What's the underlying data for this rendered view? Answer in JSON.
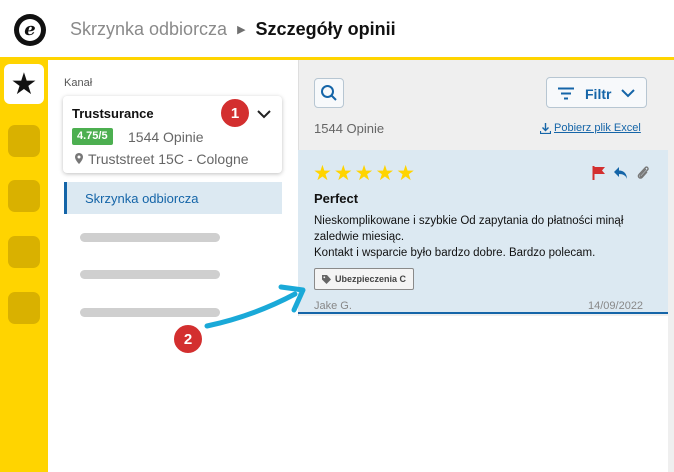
{
  "header": {
    "breadcrumb_parent": "Skrzynka odbiorcza",
    "breadcrumb_separator": "▶",
    "breadcrumb_current": "Szczegóły opinii",
    "logo_letter": "e"
  },
  "rail": {
    "active_icon": "star-icon",
    "items": [
      "rail-item",
      "rail-item",
      "rail-item",
      "rail-item"
    ]
  },
  "sidebar": {
    "channel_label": "Kanał",
    "channel": {
      "name": "Trustsurance",
      "rating": "4.75/5",
      "opinions": "1544 Opinie",
      "address": "Truststreet 15C - Cologne"
    },
    "nav_active": "Skrzynka odbiorcza"
  },
  "main": {
    "filter_label": "Filtr",
    "count": "1544 Opinie",
    "export_label": "Pobierz plik Excel"
  },
  "review": {
    "stars": "★★★★★",
    "rating": 5,
    "title": "Perfect",
    "body": "Nieskomplikowane i szybkie Od zapytania do płatności minął zaledwie miesiąc. Kontakt i wsparcie było bardzo dobre. Bardzo polecam.",
    "body_line1": "Nieskomplikowane i szybkie Od zapytania do płatności minął",
    "body_line2": "zaledwie miesiąc.",
    "body_line3": "Kontakt i wsparcie było bardzo dobre. Bardzo polecam.",
    "tag": "Ubezpieczenia C",
    "reviewer": "Jake G.",
    "date": "14/09/2022"
  },
  "annotations": {
    "marker_1": "1",
    "marker_2": "2"
  },
  "colors": {
    "brand_yellow": "#ffd400",
    "accent_blue": "#1565a8",
    "rating_green": "#4caf50",
    "marker_red": "#d32f2f",
    "arrow_cyan": "#1aa9d8"
  }
}
